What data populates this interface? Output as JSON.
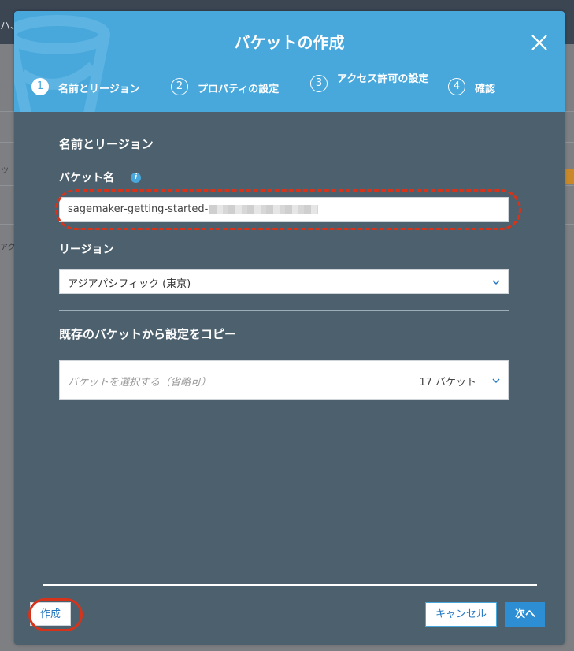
{
  "background": {
    "header_fragment": "ハ、",
    "side_fragment": "アク",
    "field_fragment": "ッ"
  },
  "modal": {
    "title": "バケットの作成",
    "steps": [
      {
        "number": "1",
        "label": "名前とリージョン",
        "active": true
      },
      {
        "number": "2",
        "label": "プロパティの設定",
        "active": false
      },
      {
        "number": "3",
        "label": "アクセス許可の設定",
        "active": false
      },
      {
        "number": "4",
        "label": "確認",
        "active": false
      }
    ],
    "section_title": "名前とリージョン",
    "bucket_name": {
      "label": "バケット名",
      "info_icon": "i",
      "value": "sagemaker-getting-started-"
    },
    "region": {
      "label": "リージョン",
      "selected": "アジアパシフィック (東京)"
    },
    "copy_settings": {
      "title": "既存のバケットから設定をコピー",
      "placeholder": "バケットを選択する（省略可）",
      "count": "17 バケット"
    },
    "buttons": {
      "create": "作成",
      "cancel": "キャンセル",
      "next": "次へ"
    }
  },
  "colors": {
    "header": "#48a8dc",
    "body": "#4c606e",
    "highlight": "#d7331a",
    "primary_button": "#2d8ed4"
  },
  "icons": {
    "close": "close-icon",
    "chevron": "chevron-down-icon",
    "info": "info-icon",
    "decoration": "bucket-watermark-icon"
  }
}
